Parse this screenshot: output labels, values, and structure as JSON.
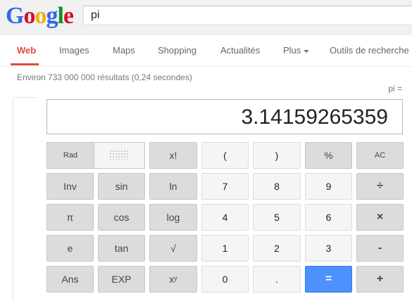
{
  "header": {
    "logo_letters": [
      {
        "ch": "G",
        "color": "#3369e8"
      },
      {
        "ch": "o",
        "color": "#d50f25"
      },
      {
        "ch": "o",
        "color": "#eeb211"
      },
      {
        "ch": "g",
        "color": "#3369e8"
      },
      {
        "ch": "l",
        "color": "#009925"
      },
      {
        "ch": "e",
        "color": "#d50f25"
      }
    ],
    "search_value": "pi"
  },
  "nav": {
    "tabs": [
      {
        "label": "Web",
        "active": true
      },
      {
        "label": "Images",
        "active": false
      },
      {
        "label": "Maps",
        "active": false
      },
      {
        "label": "Shopping",
        "active": false
      },
      {
        "label": "Actualités",
        "active": false
      },
      {
        "label": "Plus",
        "active": false
      },
      {
        "label": "Outils de recherche",
        "active": false
      }
    ]
  },
  "results": {
    "stats": "Environ 733 000 000 résultats (0,24 secondes)"
  },
  "calculator": {
    "expression": "pi =",
    "display": "3.14159265359",
    "rad_label": "Rad",
    "buttons": {
      "fact": "x!",
      "lparen": "(",
      "rparen": ")",
      "percent": "%",
      "ac": "AC",
      "inv": "Inv",
      "sin": "sin",
      "ln": "ln",
      "n7": "7",
      "n8": "8",
      "n9": "9",
      "divide": "÷",
      "pi": "π",
      "cos": "cos",
      "log": "log",
      "n4": "4",
      "n5": "5",
      "n6": "6",
      "multiply": "×",
      "e": "e",
      "tan": "tan",
      "sqrt": "√",
      "n1": "1",
      "n2": "2",
      "n3": "3",
      "minus": "-",
      "ans": "Ans",
      "exp": "EXP",
      "pow": "xʸ",
      "n0": "0",
      "dot": ".",
      "equals": "=",
      "plus": "+"
    }
  }
}
